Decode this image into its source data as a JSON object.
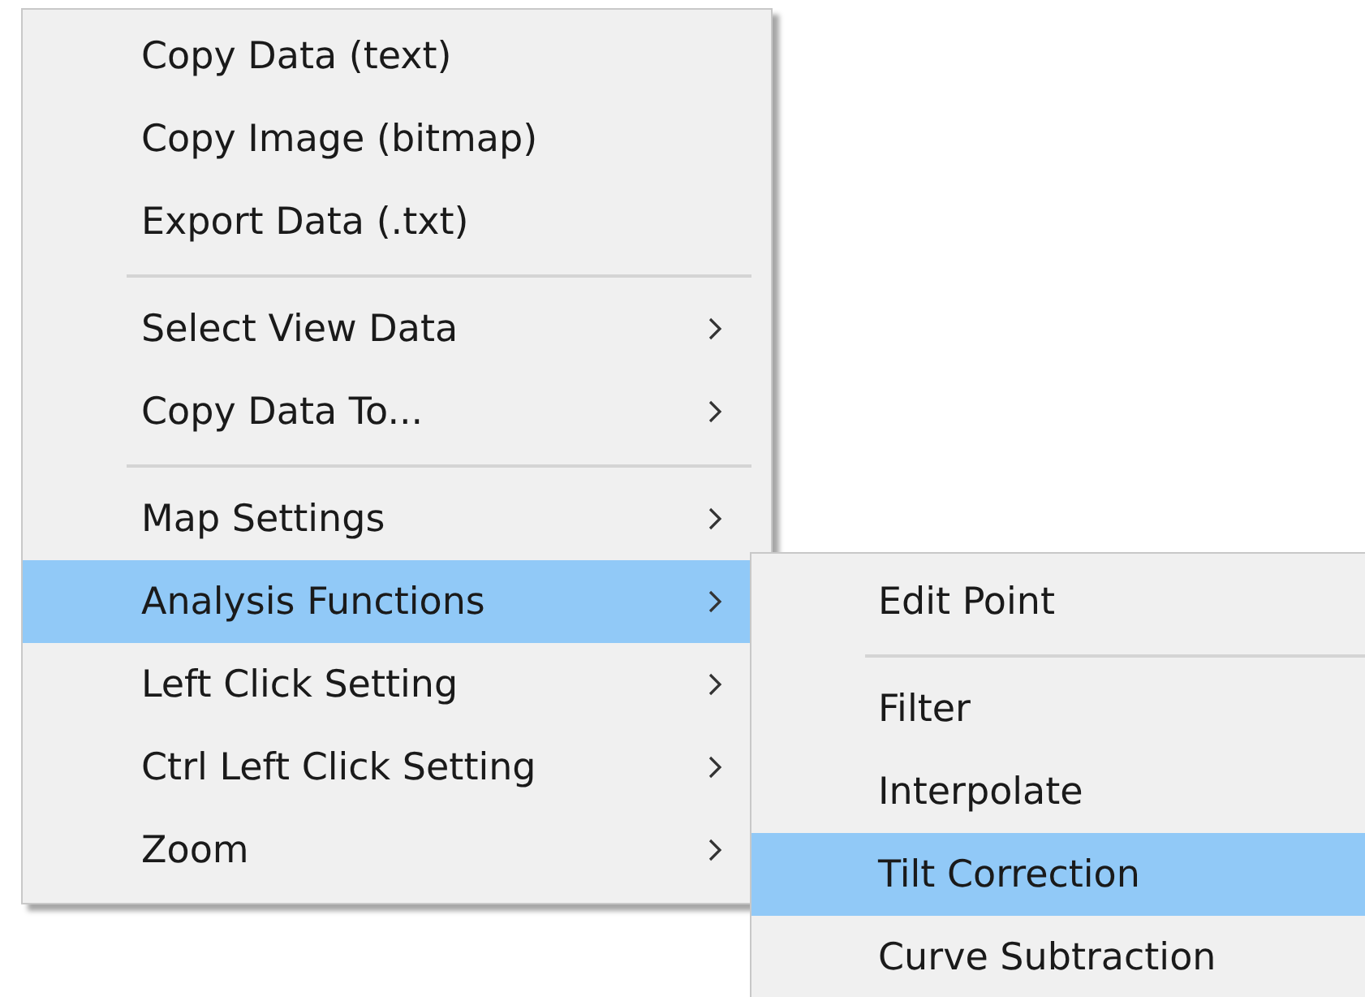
{
  "context_menu": {
    "items": [
      {
        "kind": "item",
        "label": "Copy Data (text)",
        "has_submenu": false,
        "selected": false
      },
      {
        "kind": "item",
        "label": "Copy Image (bitmap)",
        "has_submenu": false,
        "selected": false
      },
      {
        "kind": "item",
        "label": "Export Data (.txt)",
        "has_submenu": false,
        "selected": false
      },
      {
        "kind": "separator"
      },
      {
        "kind": "item",
        "label": "Select View Data",
        "has_submenu": true,
        "selected": false
      },
      {
        "kind": "item",
        "label": "Copy Data To...",
        "has_submenu": true,
        "selected": false
      },
      {
        "kind": "separator"
      },
      {
        "kind": "item",
        "label": "Map Settings",
        "has_submenu": true,
        "selected": false
      },
      {
        "kind": "item",
        "label": "Analysis Functions",
        "has_submenu": true,
        "selected": true
      },
      {
        "kind": "item",
        "label": "Left Click Setting",
        "has_submenu": true,
        "selected": false
      },
      {
        "kind": "item",
        "label": "Ctrl Left Click Setting",
        "has_submenu": true,
        "selected": false
      },
      {
        "kind": "item",
        "label": "Zoom",
        "has_submenu": true,
        "selected": false
      }
    ]
  },
  "submenu": {
    "items": [
      {
        "kind": "item",
        "label": "Edit Point",
        "selected": false
      },
      {
        "kind": "separator"
      },
      {
        "kind": "item",
        "label": "Filter",
        "selected": false
      },
      {
        "kind": "item",
        "label": "Interpolate",
        "selected": false
      },
      {
        "kind": "item",
        "label": "Tilt Correction",
        "selected": true
      },
      {
        "kind": "item",
        "label": "Curve Subtraction",
        "selected": false
      }
    ]
  }
}
